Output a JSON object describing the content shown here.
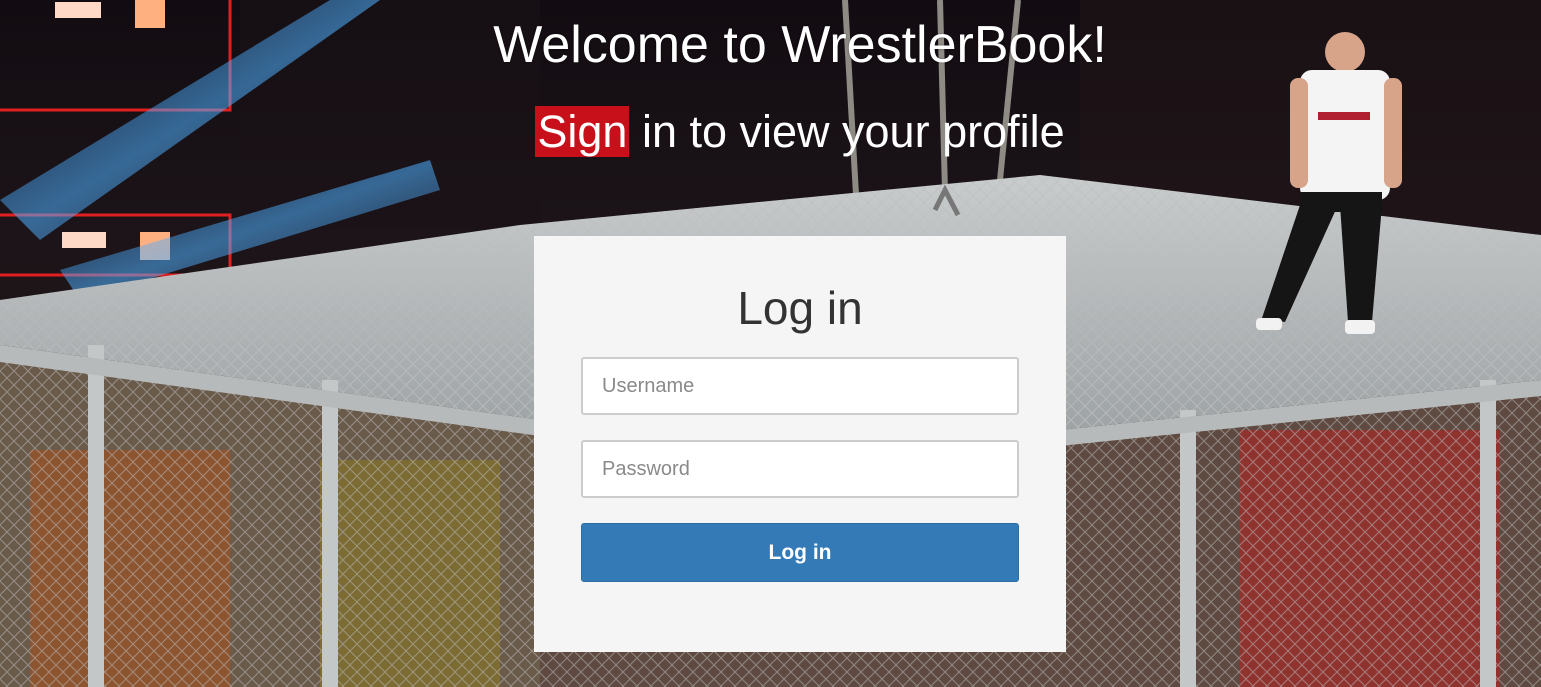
{
  "header": {
    "title": "Welcome to WrestlerBook!",
    "subtitle_highlight": "Sign",
    "subtitle_rest": " in to view your profile"
  },
  "login": {
    "title": "Log in",
    "username_placeholder": "Username",
    "password_placeholder": "Password",
    "submit_label": "Log in"
  },
  "colors": {
    "highlight": "#c8101a",
    "button": "#337ab7",
    "card_bg": "#f5f5f5"
  },
  "background": {
    "description_icon": "wrestling-arena-photo"
  }
}
